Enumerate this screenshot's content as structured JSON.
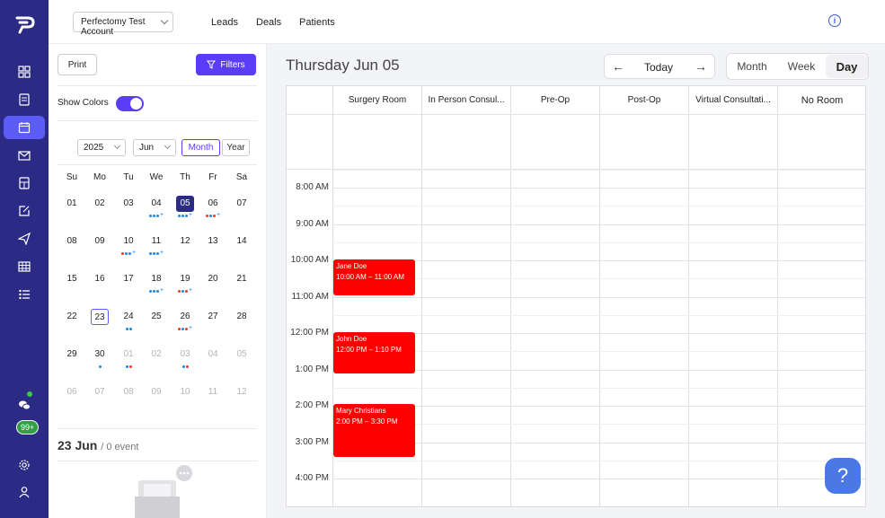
{
  "topbar": {
    "account": "Perfectomy Test Account",
    "nav": [
      "Leads",
      "Deals",
      "Patients"
    ]
  },
  "rail": {
    "badge": "99+",
    "icons": [
      "dashboard-icon",
      "clipboard-icon",
      "calendar-icon",
      "mail-icon",
      "calculator-icon",
      "edit-icon",
      "send-icon",
      "table-icon",
      "list-icon"
    ]
  },
  "left": {
    "print_label": "Print",
    "filters_label": "Filters",
    "show_colors_label": "Show Colors",
    "year": "2025",
    "month": "Jun",
    "month_label": "Month",
    "year_label": "Year",
    "dow": [
      "Su",
      "Mo",
      "Tu",
      "We",
      "Th",
      "Fr",
      "Sa"
    ],
    "weeks": [
      [
        "01",
        "02",
        "03",
        "04",
        "05",
        "06",
        "07"
      ],
      [
        "08",
        "09",
        "10",
        "11",
        "12",
        "13",
        "14"
      ],
      [
        "15",
        "16",
        "17",
        "18",
        "19",
        "20",
        "21"
      ],
      [
        "22",
        "23",
        "24",
        "25",
        "26",
        "27",
        "28"
      ],
      [
        "29",
        "30",
        "01",
        "02",
        "03",
        "04",
        "05"
      ],
      [
        "06",
        "07",
        "08",
        "09",
        "10",
        "11",
        "12"
      ]
    ],
    "summary_date": "23 Jun",
    "summary_count": "/ 0 event"
  },
  "main": {
    "title": "Thursday Jun 05",
    "today_label": "Today",
    "views": [
      "Month",
      "Week",
      "Day"
    ],
    "active_view": "Day",
    "rooms": [
      "Surgery Room",
      "In Person Consul...",
      "Pre-Op",
      "Post-Op",
      "Virtual Consultati...",
      "No Room"
    ],
    "times": [
      "8:00 AM",
      "9:00 AM",
      "10:00 AM",
      "11:00 AM",
      "12:00 PM",
      "1:00 PM",
      "2:00 PM",
      "3:00 PM",
      "4:00 PM"
    ],
    "events": [
      {
        "name": "Jane Doe",
        "time": "10:00 AM – 11:00 AM",
        "room": "Surgery Room"
      },
      {
        "name": "John Doe",
        "time": "12:00 PM – 1:10 PM",
        "room": "Surgery Room"
      },
      {
        "name": "Mary Christians",
        "time": "2:00 PM – 3:30 PM",
        "room": "Surgery Room"
      }
    ],
    "event_color": "#ff0000",
    "help_label": "?"
  },
  "colors": {
    "rail": "#2b2b86",
    "accent": "#5b3df5",
    "event": "#ff0000"
  }
}
